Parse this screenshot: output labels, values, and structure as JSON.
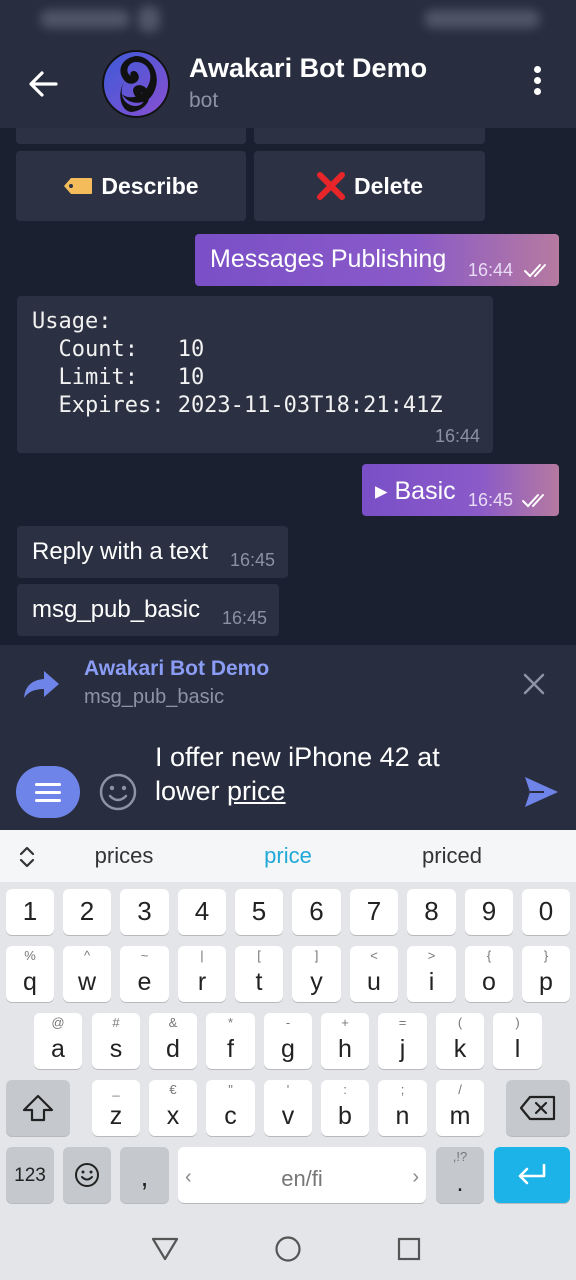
{
  "header": {
    "title": "Awakari Bot Demo",
    "subtitle": "bot"
  },
  "chat": {
    "keyboard_buttons": [
      {
        "label": "Describe",
        "icon": "label-tag-icon"
      },
      {
        "label": "Delete",
        "icon": "red-cross-icon"
      }
    ],
    "messages": [
      {
        "dir": "out",
        "text": "Messages Publishing",
        "time": "16:44"
      },
      {
        "dir": "in",
        "mono": true,
        "text": "Usage:\n  Count:   10\n  Limit:   10\n  Expires: 2023-11-03T18:21:41Z",
        "time": "16:44"
      },
      {
        "dir": "out",
        "text": "▸ Basic",
        "time": "16:45"
      },
      {
        "dir": "in",
        "text": "Reply with a text",
        "time": "16:45"
      },
      {
        "dir": "in",
        "text": "msg_pub_basic",
        "time": "16:45"
      }
    ]
  },
  "reply": {
    "name": "Awakari Bot Demo",
    "text": "msg_pub_basic"
  },
  "input": {
    "text_before": "I offer new iPhone 42 at lower ",
    "text_underlined": "price"
  },
  "keyboard": {
    "suggestions": [
      "prices",
      "price",
      "priced"
    ],
    "numbers": [
      "1",
      "2",
      "3",
      "4",
      "5",
      "6",
      "7",
      "8",
      "9",
      "0"
    ],
    "row1": [
      {
        "k": "q",
        "h": "%"
      },
      {
        "k": "w",
        "h": "^"
      },
      {
        "k": "e",
        "h": "~"
      },
      {
        "k": "r",
        "h": "|"
      },
      {
        "k": "t",
        "h": "["
      },
      {
        "k": "y",
        "h": "]"
      },
      {
        "k": "u",
        "h": "<"
      },
      {
        "k": "i",
        "h": ">"
      },
      {
        "k": "o",
        "h": "{"
      },
      {
        "k": "p",
        "h": "}"
      }
    ],
    "row2": [
      {
        "k": "a",
        "h": "@"
      },
      {
        "k": "s",
        "h": "#"
      },
      {
        "k": "d",
        "h": "&"
      },
      {
        "k": "f",
        "h": "*"
      },
      {
        "k": "g",
        "h": "-"
      },
      {
        "k": "h",
        "h": "+"
      },
      {
        "k": "j",
        "h": "="
      },
      {
        "k": "k",
        "h": "("
      },
      {
        "k": "l",
        "h": ")"
      }
    ],
    "row3": [
      {
        "k": "z",
        "h": "_"
      },
      {
        "k": "x",
        "h": "€"
      },
      {
        "k": "c",
        "h": "\""
      },
      {
        "k": "v",
        "h": "'"
      },
      {
        "k": "b",
        "h": ":"
      },
      {
        "k": "n",
        "h": ";"
      },
      {
        "k": "m",
        "h": "/"
      }
    ],
    "mode_key": "123",
    "comma": ",",
    "space_label": "en/fi",
    "period": ".",
    "period_hint": ",!?"
  },
  "colors": {
    "background": "#1a2030",
    "header": "#282e3f",
    "bubble_in": "#2b3142",
    "accent": "#6f84e8",
    "reply_name": "#8b9cf5",
    "suggestion_active": "#20a8d8",
    "enter_key": "#1cb4e8"
  }
}
